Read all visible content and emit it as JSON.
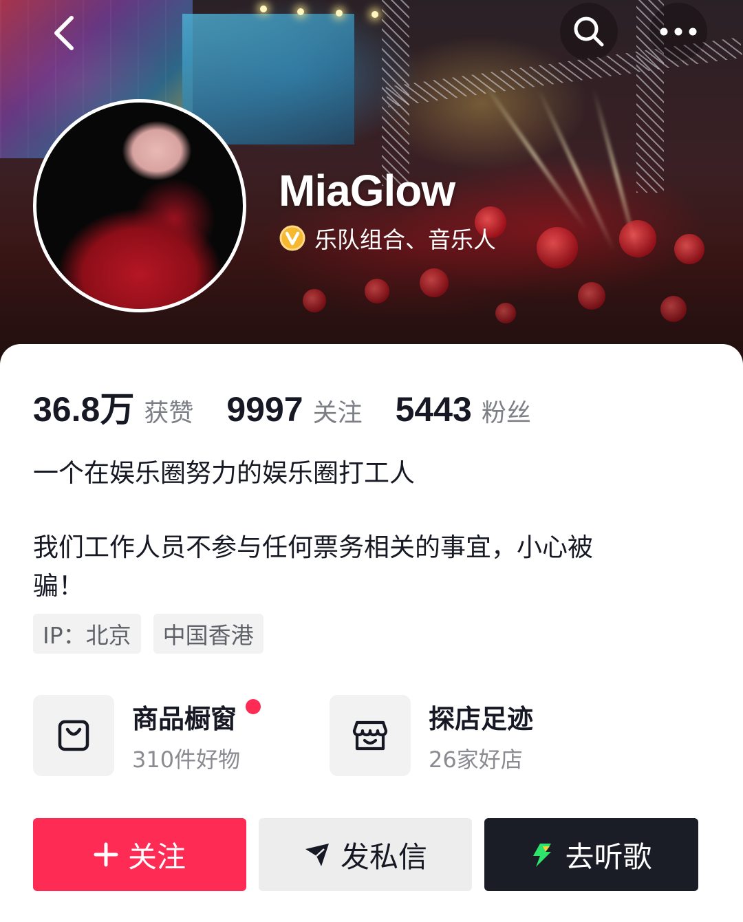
{
  "header": {
    "back_icon": "chevron-left-icon",
    "search_icon": "search-icon",
    "more_icon": "more-horizontal-icon"
  },
  "profile": {
    "username": "MiaGlow",
    "verified_badge": "verified-v-icon",
    "verified_color": "#f5b82e",
    "verified_label": "乐队组合、音乐人"
  },
  "stats": [
    {
      "value": "36.8万",
      "label": "获赞"
    },
    {
      "value": "9997",
      "label": "关注"
    },
    {
      "value": "5443",
      "label": "粉丝"
    }
  ],
  "bio": {
    "line1": "一个在娱乐圈努力的娱乐圈打工人",
    "line2": "我们工作人员不参与任何票务相关的事宜，小心被",
    "line3": "骗！"
  },
  "tags": [
    {
      "label": "IP：北京"
    },
    {
      "label": "中国香港"
    }
  ],
  "features": [
    {
      "title": "商品橱窗",
      "subtitle": "310件好物",
      "icon": "shopping-bag-icon",
      "has_dot": true
    },
    {
      "title": "探店足迹",
      "subtitle": "26家好店",
      "icon": "store-icon",
      "has_dot": false
    }
  ],
  "actions": {
    "follow_label": "关注",
    "message_label": "发私信",
    "listen_label": "去听歌"
  },
  "colors": {
    "follow_bg": "#fe2c55",
    "listen_bg": "#1a1c26",
    "text_primary": "#161823",
    "text_secondary": "#7c7f86"
  }
}
